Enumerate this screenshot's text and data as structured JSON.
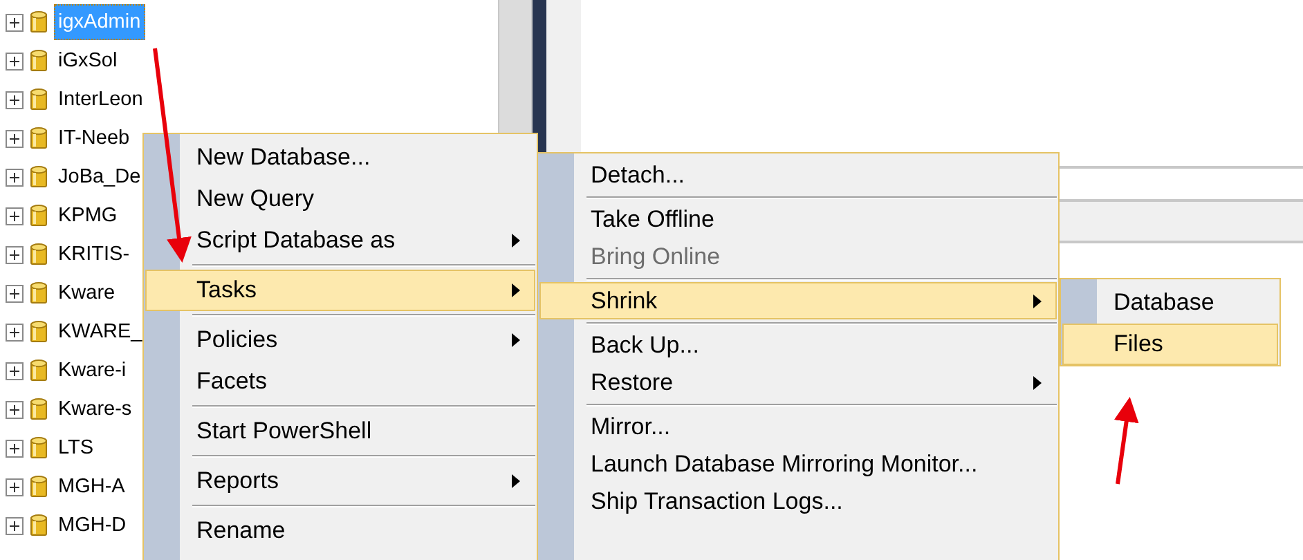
{
  "tree": {
    "items": [
      {
        "label": "igxAdmin",
        "selected": true,
        "expanded": false
      },
      {
        "label": "iGxSol",
        "selected": false,
        "expanded": false
      },
      {
        "label": "InterLeon",
        "selected": false,
        "expanded": false
      },
      {
        "label": "IT-Neeb",
        "selected": false,
        "expanded": false
      },
      {
        "label": "JoBa_De",
        "selected": false,
        "expanded": false
      },
      {
        "label": "KPMG",
        "selected": false,
        "expanded": false
      },
      {
        "label": "KRITIS-",
        "selected": false,
        "expanded": false
      },
      {
        "label": "Kware",
        "selected": false,
        "expanded": false
      },
      {
        "label": "KWARE_",
        "selected": false,
        "expanded": false
      },
      {
        "label": "Kware-i",
        "selected": false,
        "expanded": false
      },
      {
        "label": "Kware-s",
        "selected": false,
        "expanded": false
      },
      {
        "label": "LTS",
        "selected": false,
        "expanded": false
      },
      {
        "label": "MGH-A",
        "selected": false,
        "expanded": false
      },
      {
        "label": "MGH-D",
        "selected": false,
        "expanded": false
      }
    ]
  },
  "context_menu": {
    "items": [
      {
        "kind": "item",
        "label": "New Database...",
        "selected": false,
        "has_submenu": false
      },
      {
        "kind": "item",
        "label": "New Query",
        "selected": false,
        "has_submenu": false
      },
      {
        "kind": "item",
        "label": "Script Database as",
        "selected": false,
        "has_submenu": true
      },
      {
        "kind": "separator"
      },
      {
        "kind": "item",
        "label": "Tasks",
        "selected": true,
        "has_submenu": true
      },
      {
        "kind": "separator"
      },
      {
        "kind": "item",
        "label": "Policies",
        "selected": false,
        "has_submenu": true
      },
      {
        "kind": "item",
        "label": "Facets",
        "selected": false,
        "has_submenu": false
      },
      {
        "kind": "separator"
      },
      {
        "kind": "item",
        "label": "Start PowerShell",
        "selected": false,
        "has_submenu": false
      },
      {
        "kind": "separator"
      },
      {
        "kind": "item",
        "label": "Reports",
        "selected": false,
        "has_submenu": true
      },
      {
        "kind": "separator"
      },
      {
        "kind": "item",
        "label": "Rename",
        "selected": false,
        "has_submenu": false
      }
    ]
  },
  "tasks_submenu": {
    "items": [
      {
        "kind": "item",
        "label": "Detach...",
        "selected": false,
        "disabled": false,
        "has_submenu": false
      },
      {
        "kind": "separator"
      },
      {
        "kind": "item",
        "label": "Take Offline",
        "selected": false,
        "disabled": false,
        "has_submenu": false
      },
      {
        "kind": "item",
        "label": "Bring Online",
        "selected": false,
        "disabled": true,
        "has_submenu": false
      },
      {
        "kind": "separator"
      },
      {
        "kind": "item",
        "label": "Shrink",
        "selected": true,
        "disabled": false,
        "has_submenu": true
      },
      {
        "kind": "separator"
      },
      {
        "kind": "item",
        "label": "Back Up...",
        "selected": false,
        "disabled": false,
        "has_submenu": false
      },
      {
        "kind": "item",
        "label": "Restore",
        "selected": false,
        "disabled": false,
        "has_submenu": true
      },
      {
        "kind": "separator"
      },
      {
        "kind": "item",
        "label": "Mirror...",
        "selected": false,
        "disabled": false,
        "has_submenu": false
      },
      {
        "kind": "item",
        "label": "Launch Database Mirroring Monitor...",
        "selected": false,
        "disabled": false,
        "has_submenu": false
      },
      {
        "kind": "item",
        "label": "Ship Transaction Logs...",
        "selected": false,
        "disabled": false,
        "has_submenu": false
      }
    ]
  },
  "shrink_submenu": {
    "items": [
      {
        "kind": "item",
        "label": "Database",
        "selected": false,
        "has_submenu": false
      },
      {
        "kind": "item",
        "label": "Files",
        "selected": true,
        "has_submenu": false
      }
    ]
  }
}
